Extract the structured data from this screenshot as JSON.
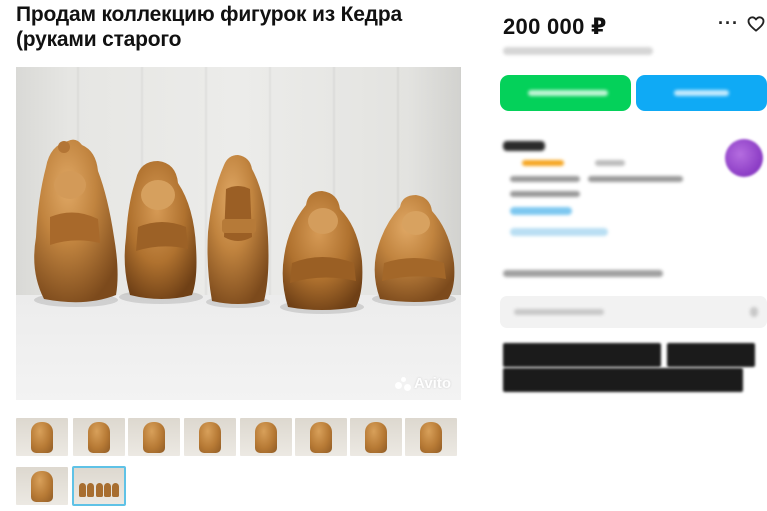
{
  "listing": {
    "title": "Продам коллекцию фигурок из Кедра (руками старого",
    "price": "200 000 ₽",
    "watermark": "Avito"
  },
  "icons": {
    "more": "more-icon",
    "favorite": "heart-icon",
    "watermark_logo": "avito-logo-icon"
  },
  "colors": {
    "call_button": "#04d15a",
    "message_button": "#0faaf5",
    "rating_bar": "#f5a623",
    "link_blur": "#7ec8f0",
    "avatar": "#8a3bc4"
  },
  "gallery": {
    "thumbnail_count": 10,
    "selected_index": 9
  }
}
